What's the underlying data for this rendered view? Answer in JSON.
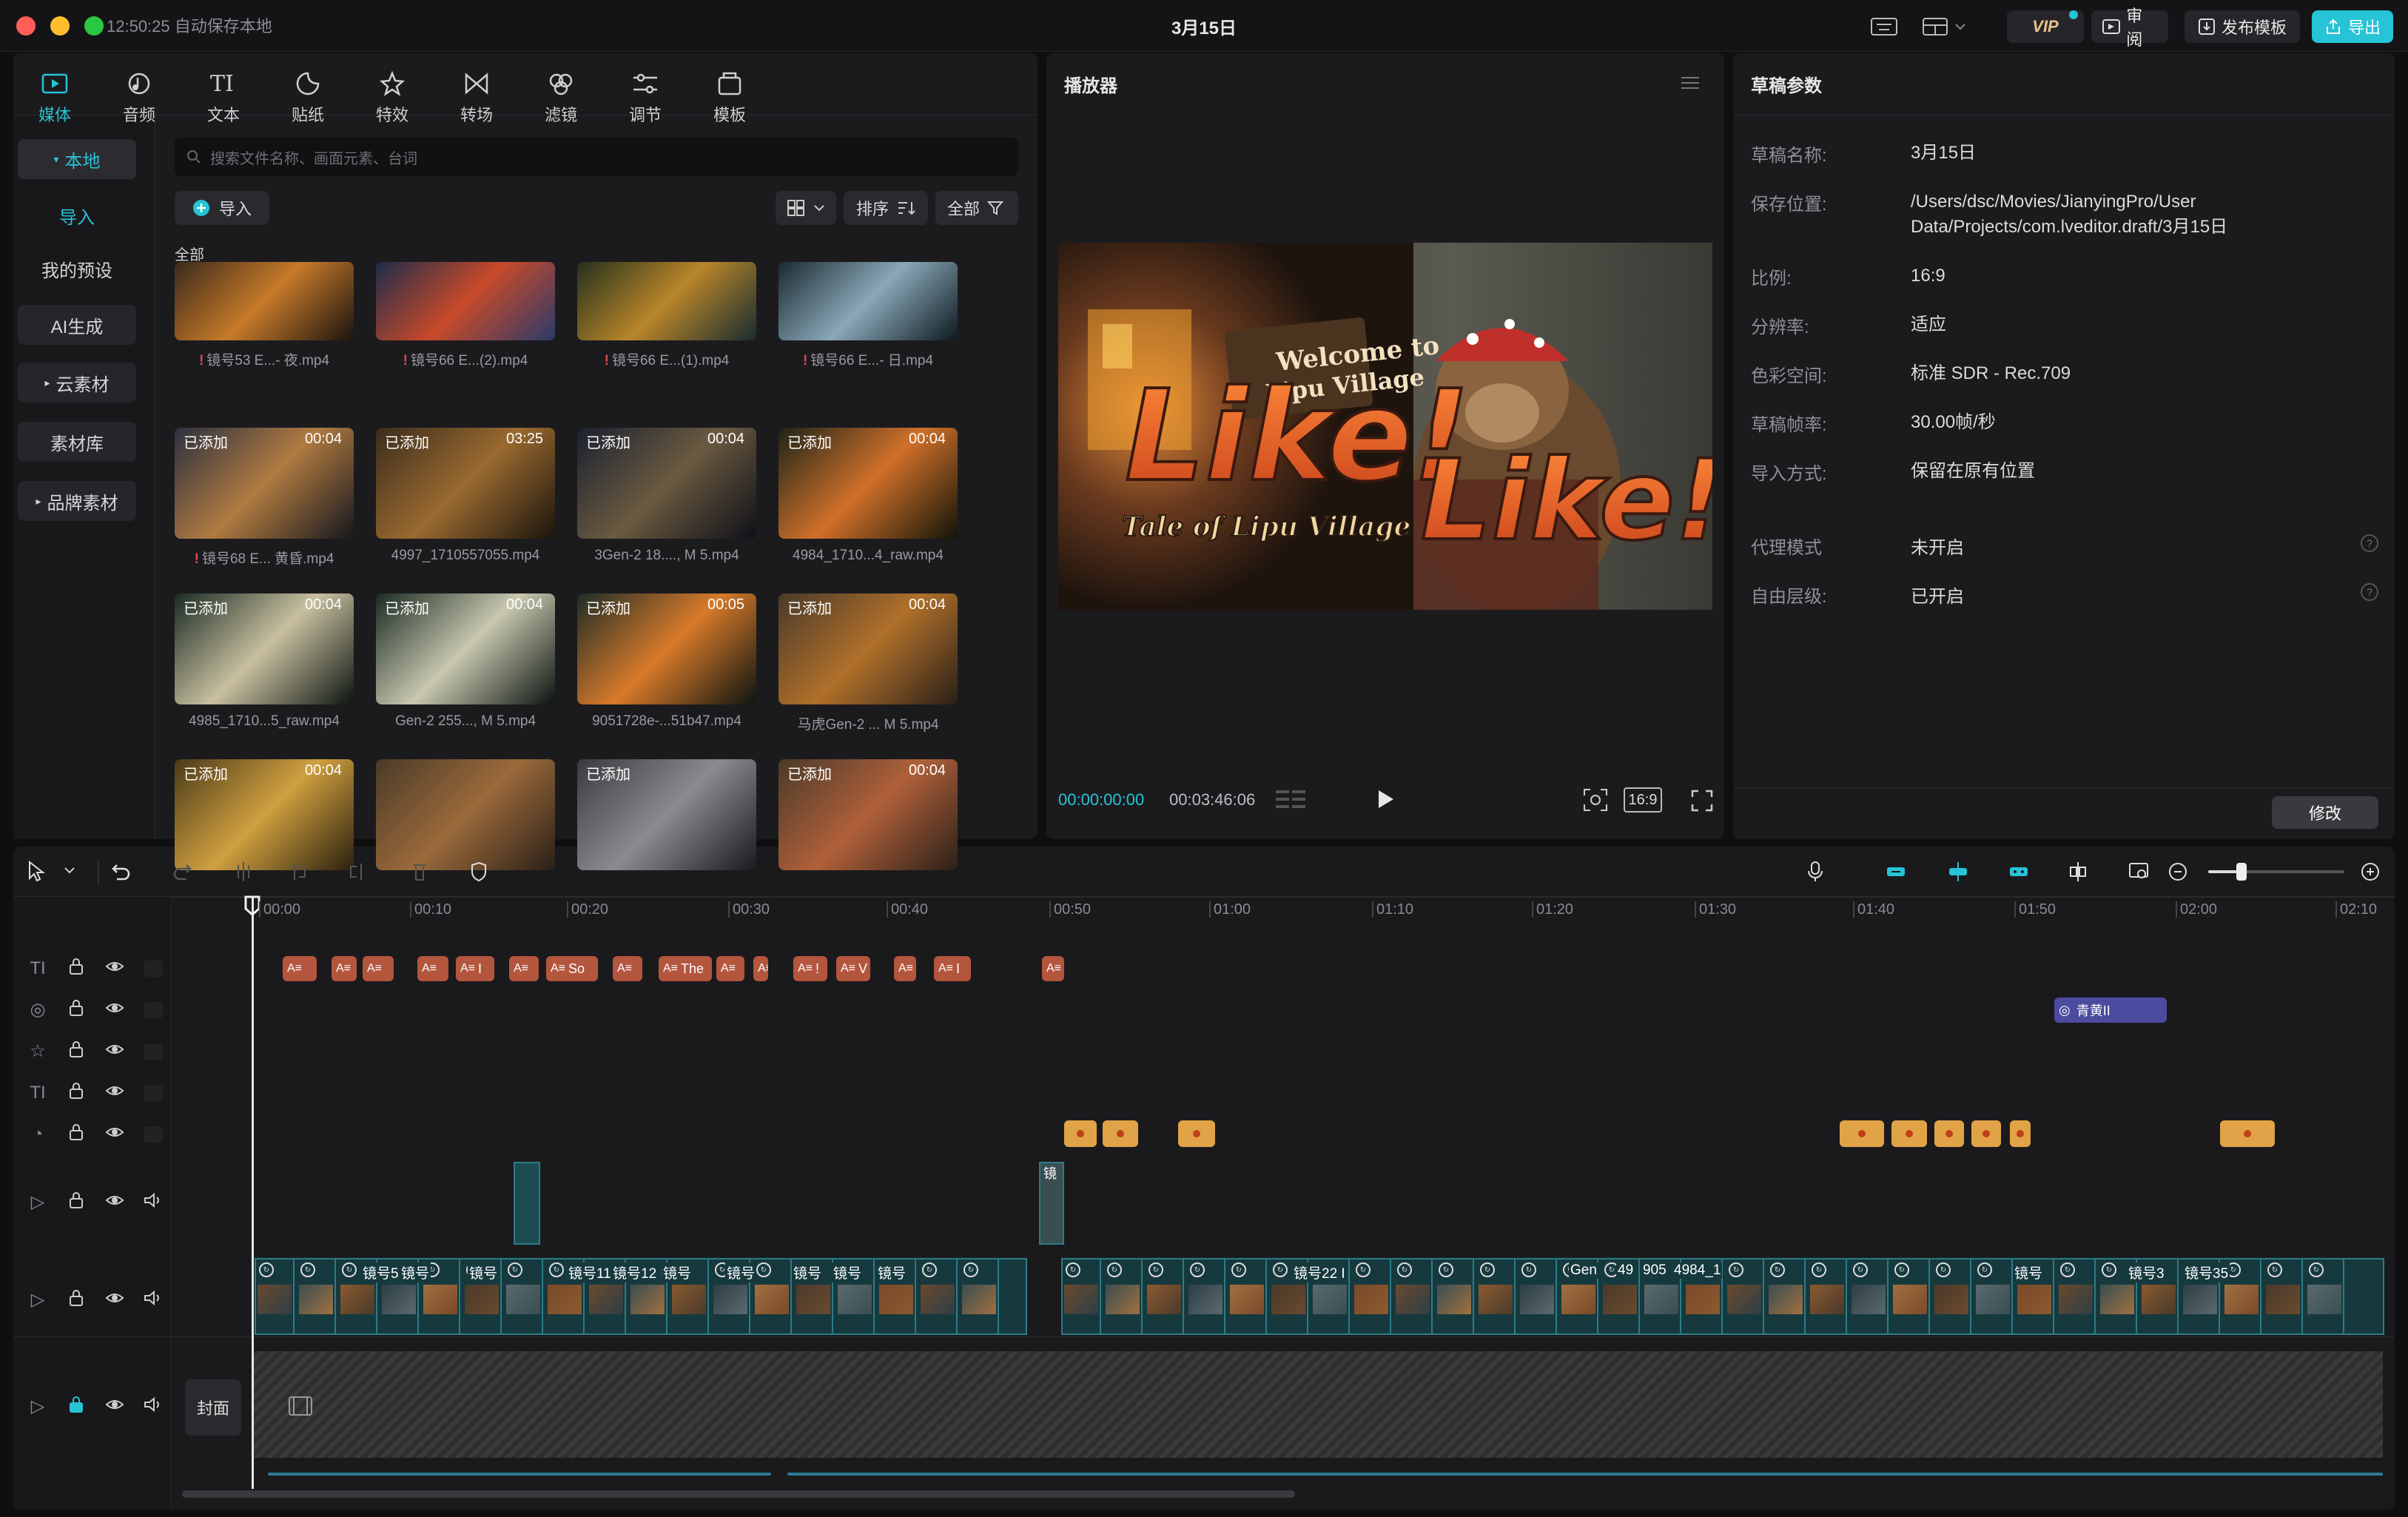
{
  "titlebar": {
    "autosave": "12:50:25 自动保存本地",
    "project_title": "3月15日",
    "vip": "VIP",
    "review": "审阅",
    "publish_template": "发布模板",
    "export": "导出"
  },
  "media_tabs": [
    {
      "label": "媒体",
      "icon": "media-icon",
      "active": true
    },
    {
      "label": "音频",
      "icon": "audio-icon"
    },
    {
      "label": "文本",
      "icon": "text-icon"
    },
    {
      "label": "贴纸",
      "icon": "sticker-icon"
    },
    {
      "label": "特效",
      "icon": "effects-icon"
    },
    {
      "label": "转场",
      "icon": "transition-icon"
    },
    {
      "label": "滤镜",
      "icon": "filter-icon"
    },
    {
      "label": "调节",
      "icon": "adjust-icon"
    },
    {
      "label": "模板",
      "icon": "template-icon"
    }
  ],
  "sidebar": {
    "items": [
      "本地",
      "导入",
      "我的预设",
      "AI生成",
      "云素材",
      "素材库",
      "品牌素材"
    ]
  },
  "media": {
    "search_placeholder": "搜索文件名称、画面元素、台词",
    "import_label": "导入",
    "sort_label": "排序",
    "filter_label": "全部",
    "section_label": "全部",
    "added_label": "已添加",
    "rows": [
      [
        {
          "name": "镜号53 E...- 夜.mp4",
          "warn": true,
          "colors": [
            "#3a2a1a",
            "#c77a2a",
            "#1a1410"
          ]
        },
        {
          "name": "镜号66 E...(2).mp4",
          "warn": true,
          "colors": [
            "#1e2c4a",
            "#c84a2a",
            "#2a3a6a"
          ]
        },
        {
          "name": "镜号66 E...(1).mp4",
          "warn": true,
          "colors": [
            "#24301c",
            "#b8862a",
            "#1a2a30"
          ]
        },
        {
          "name": "镜号66 E...- 日.mp4",
          "warn": true,
          "colors": [
            "#1a2a30",
            "#8aa8b8",
            "#0e1a20"
          ]
        }
      ],
      [
        {
          "name": "镜号68 E... 黄昏.mp4",
          "warn": true,
          "added": true,
          "dur": "00:04",
          "colors": [
            "#2a3040",
            "#b07a40",
            "#15181e"
          ]
        },
        {
          "name": "4997_1710557055.mp4",
          "added": true,
          "dur": "03:25",
          "colors": [
            "#3a2c1c",
            "#9a6a30",
            "#1a140c"
          ]
        },
        {
          "name": "3Gen-2 18...., M 5.mp4",
          "added": true,
          "dur": "00:04",
          "colors": [
            "#1a2030",
            "#6a5a40",
            "#0e1018"
          ]
        },
        {
          "name": "4984_1710...4_raw.mp4",
          "added": true,
          "dur": "00:04",
          "colors": [
            "#1c2418",
            "#d0702a",
            "#101408"
          ]
        }
      ],
      [
        {
          "name": "4985_1710...5_raw.mp4",
          "added": true,
          "dur": "00:04",
          "colors": [
            "#1a2a22",
            "#c8c0a0",
            "#0c1410"
          ]
        },
        {
          "name": "Gen-2 255..., M 5.mp4",
          "added": true,
          "dur": "00:04",
          "colors": [
            "#1a2a22",
            "#c8c8b0",
            "#0c1410"
          ]
        },
        {
          "name": "9051728e-...51b47.mp4",
          "added": true,
          "dur": "00:05",
          "colors": [
            "#1e2c26",
            "#d87a2a",
            "#0c1410"
          ]
        },
        {
          "name": "马虎Gen-2 ... M 5.mp4",
          "added": true,
          "dur": "00:04",
          "colors": [
            "#4a3a2a",
            "#b0702a",
            "#2a2018"
          ]
        }
      ],
      [
        {
          "name": "",
          "added": true,
          "dur": "00:04",
          "colors": [
            "#4a3a18",
            "#d0a040",
            "#2a2010"
          ]
        },
        {
          "name": "",
          "colors": [
            "#4a3a28",
            "#9a6a3a",
            "#2a2018"
          ]
        },
        {
          "name": "",
          "added": true,
          "colors": [
            "#3a3a3e",
            "#8a8a90",
            "#1a1a1e"
          ]
        },
        {
          "name": "",
          "added": true,
          "dur": "00:04",
          "colors": [
            "#4a3a28",
            "#b0603a",
            "#2a2018"
          ]
        }
      ]
    ]
  },
  "player": {
    "title": "播放器",
    "preview_text": {
      "welcome": "Welcome to",
      "village": "Lipu Village",
      "like1": "Like!",
      "like2": "Like!",
      "tale": "Tale of Lipu Village"
    },
    "current_time": "00:00:00:00",
    "total_time": "00:03:46:06",
    "ratio": "16:9"
  },
  "draft": {
    "title": "草稿参数",
    "props": [
      {
        "label": "草稿名称:",
        "value": "3月15日"
      },
      {
        "label": "保存位置:",
        "value": "/Users/dsc/Movies/JianyingPro/User Data/Projects/com.lveditor.draft/3月15日"
      },
      {
        "label": "比例:",
        "value": "16:9"
      },
      {
        "label": "分辨率:",
        "value": "适应"
      },
      {
        "label": "色彩空间:",
        "value": "标准 SDR - Rec.709"
      },
      {
        "label": "草稿帧率:",
        "value": "30.00帧/秒"
      },
      {
        "label": "导入方式:",
        "value": "保留在原有位置"
      }
    ],
    "props2": [
      {
        "label": "代理模式",
        "value": "未开启"
      },
      {
        "label": "自由层级:",
        "value": "已开启"
      }
    ],
    "modify": "修改"
  },
  "timeline": {
    "ruler": [
      "00:00",
      "00:10",
      "00:20",
      "00:30",
      "00:40",
      "00:50",
      "01:00",
      "01:10",
      "01:20",
      "01:30",
      "01:40",
      "01:50",
      "02:00",
      "02:10"
    ],
    "filter_chip": "青黄II",
    "cover_label": "封面",
    "text_chips": [
      "",
      "",
      "",
      "",
      "I",
      "",
      "So",
      "",
      "The",
      "",
      "",
      "!",
      "V",
      "",
      "I",
      ""
    ],
    "main_clip_labels": [
      "镜号5 E",
      "镜号",
      "镜号",
      "镜号11 E",
      "镜号12 E",
      "镜号",
      "镜号",
      "镜号",
      "镜号",
      "镜号",
      "镜号22 I",
      "Gen",
      "49",
      "905",
      "4984_1",
      "镜号",
      "镜号3",
      "镜号35"
    ],
    "overlay_clip_label": "镜"
  },
  "colors": {
    "accent": "#27c3d6",
    "text_chip": "#b4553e",
    "sticker": "#e0a347",
    "filter": "#4b4ba0",
    "clip": "#1c4c52"
  }
}
